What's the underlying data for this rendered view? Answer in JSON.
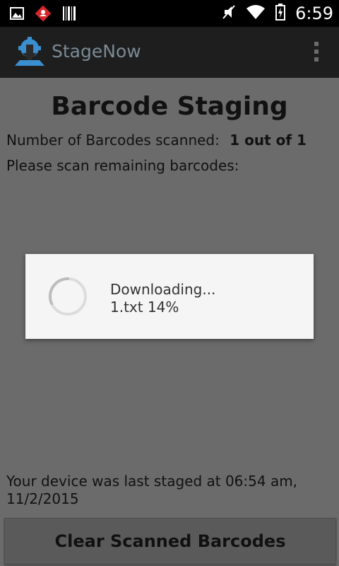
{
  "status_bar": {
    "time": "6:59",
    "icons": [
      "image-icon",
      "notification-badge-icon",
      "barcode-icon",
      "mute-icon",
      "wifi-icon",
      "battery-icon"
    ]
  },
  "action_bar": {
    "title": "StageNow",
    "icon": "stagenow-logo-icon"
  },
  "main": {
    "title": "Barcode Staging",
    "count_label": "Number of Barcodes scanned:",
    "count_value": "1 out of 1",
    "instructions": "Please scan remaining barcodes:",
    "last_staged_line1": "Your device was last staged at 06:54 am,",
    "last_staged_line2": "11/2/2015",
    "clear_button_label": "Clear Scanned Barcodes"
  },
  "dialog": {
    "message": "Downloading...",
    "progress_text": "1.txt 14%",
    "progress_percent": 14
  },
  "colors": {
    "accent": "#3a8fd0",
    "overlay_background": "#6b6b6b",
    "dialog_background": "#f5f5f5"
  }
}
